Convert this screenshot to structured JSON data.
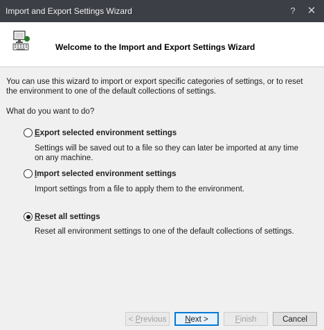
{
  "window": {
    "title": "Import and Export Settings Wizard",
    "help_glyph": "?",
    "close_glyph": "✕"
  },
  "header": {
    "title": "Welcome to the Import and Export Settings Wizard",
    "icon": "settings-wizard-icon"
  },
  "body": {
    "intro": "You can use this wizard to import or export specific categories of settings, or to reset the environment to one of the default collections of settings.",
    "question": "What do you want to do?",
    "options": [
      {
        "label": "Export selected environment settings",
        "description": "Settings will be saved out to a file so they can later be imported at any time on any machine.",
        "selected": false
      },
      {
        "label": "Import selected environment settings",
        "description": "Import settings from a file to apply them to the environment.",
        "selected": false
      },
      {
        "label": "Reset all settings",
        "description": "Reset all environment settings to one of the default collections of settings.",
        "selected": true
      }
    ]
  },
  "buttons": {
    "previous": "< Previous",
    "next": "Next >",
    "finish": "Finish",
    "cancel": "Cancel"
  },
  "colors": {
    "titlebar": "#3c3f45",
    "accent": "#0078d7",
    "content_bg": "#f0f0f0"
  }
}
